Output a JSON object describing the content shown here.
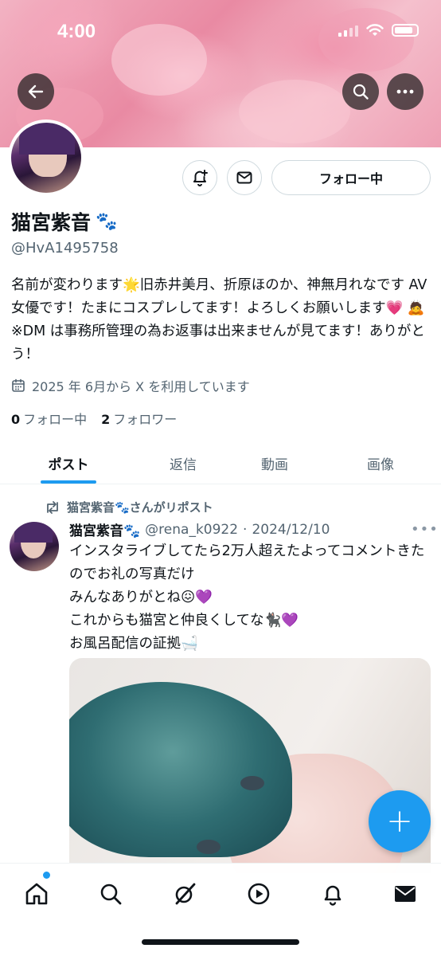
{
  "status_bar": {
    "time": "4:00"
  },
  "profile": {
    "display_name": "猫宮紫音",
    "name_emoji": "🐾",
    "handle": "@HvA1495758",
    "follow_button_label": "フォロー中",
    "bio": "名前が変わります🌟旧赤井美月、折原ほのか、神無月れなです AV 女優です！たまにコスプレしてます！よろしくお願いします💗 🙇 ※DM は事務所管理の為お返事は出来ませんが見てます！ありがとう！",
    "joined": "2025 年 6月から X を利用しています",
    "following_count": "0",
    "following_label": "フォロー中",
    "followers_count": "2",
    "followers_label": "フォロワー"
  },
  "tabs": [
    {
      "label": "ポスト",
      "active": true
    },
    {
      "label": "返信",
      "active": false
    },
    {
      "label": "動画",
      "active": false
    },
    {
      "label": "画像",
      "active": false
    }
  ],
  "post": {
    "repost_label": "猫宮紫音🐾さんがリポスト",
    "author_name": "猫宮紫音🐾",
    "author_handle": "@rena_k0922",
    "separator": "·",
    "date": "2024/12/10",
    "more": "•••",
    "lines": [
      "インスタライブしてたら2万人超えたよってコメントきたのでお礼の写真だけ",
      "みんなありがとね😖💜",
      "これからも猫宮と仲良くしてな🐈‍⬛💜",
      "お風呂配信の証拠🛁"
    ]
  },
  "fab_label": "+",
  "colors": {
    "accent": "#1d9bf0",
    "text": "#0f1419",
    "secondary": "#536471"
  }
}
